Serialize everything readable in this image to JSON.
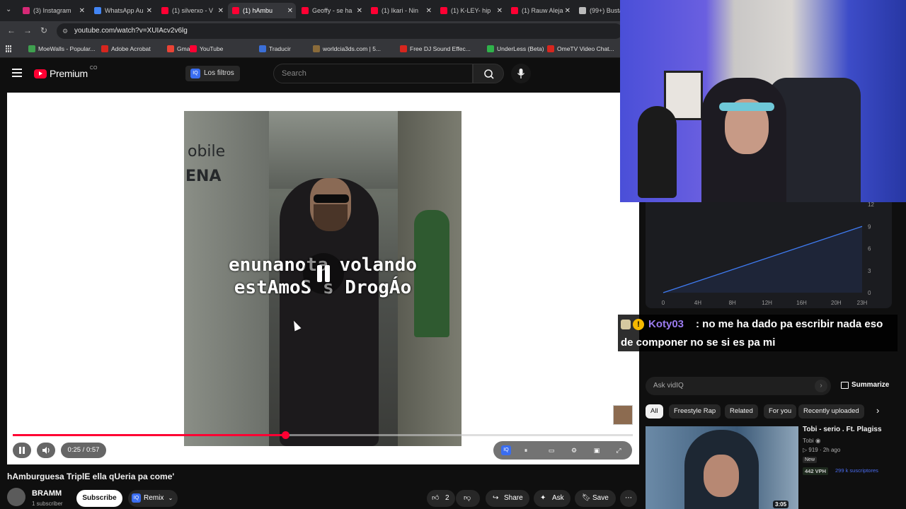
{
  "browser": {
    "tabs": [
      {
        "label": "(3) Instagram",
        "color": "#d62976"
      },
      {
        "label": "WhatsApp Au",
        "color": "#4285f4"
      },
      {
        "label": "(1) silverxo - V",
        "color": "#ff0033"
      },
      {
        "label": "(1) hAmbu",
        "color": "#ff0033",
        "active": true
      },
      {
        "label": "Geoffy - se ha",
        "color": "#ff0033"
      },
      {
        "label": "(1) Ikari - Nin",
        "color": "#ff0033"
      },
      {
        "label": "(1) K-LEY- hip",
        "color": "#ff0033"
      },
      {
        "label": "(1) Rauw Aleja",
        "color": "#ff0033"
      },
      {
        "label": "(99+) Busta",
        "color": "#bbbbbb"
      }
    ],
    "url": "youtube.com/watch?v=XUIAcv2v6lg",
    "bookmarks": [
      "MoeWalls - Popular...",
      "Adobe Acrobat",
      "Gmail",
      "YouTube",
      "Traducir",
      "worldcia3ds.com | 5...",
      "Free DJ Sound Effec...",
      "UnderLess (Beta)",
      "OmeTV Video Chat..."
    ]
  },
  "youtube": {
    "logo_text": "Premium",
    "country": "CO",
    "filters_label": "Los filtros",
    "filters_icon": "IQ",
    "search_placeholder": "Search"
  },
  "player": {
    "caption_line1": "enunanota volando",
    "caption_line2": "estAmoS   s DrogÁo",
    "sign1": "obile",
    "sign2": "ENA",
    "time": "0:25 / 0:57",
    "progress_fraction": 0.439
  },
  "video": {
    "title": "hAmburguesa TriplE ella qUeria pa come'",
    "channel": "BRAMM",
    "subscribers": "1 subscriber",
    "subscribe_label": "Subscribe",
    "remix_label": "Remix",
    "remix_icon": "IQ",
    "likes": "2",
    "share_label": "Share",
    "ask_label": "Ask",
    "save_label": "Save"
  },
  "stats_chart": {
    "y_ticks": [
      "12",
      "9",
      "6",
      "3",
      "0"
    ],
    "x_ticks": [
      "0",
      "4H",
      "8H",
      "12H",
      "16H",
      "20H",
      "23H"
    ]
  },
  "chart_data": {
    "type": "line",
    "x": [
      0,
      23
    ],
    "series": [
      {
        "values": [
          0,
          9
        ]
      }
    ],
    "ylim": [
      0,
      12
    ],
    "xticks": [
      "0",
      "4H",
      "8H",
      "12H",
      "16H",
      "20H",
      "23H"
    ],
    "yticks": [
      "0",
      "3",
      "6",
      "9",
      "12"
    ]
  },
  "chat": {
    "badge_symbol": "!",
    "username": "Koty03",
    "line1": ": no me ha dado pa escribir nada eso",
    "line2": "de componer no se si es pa mi"
  },
  "sidebar": {
    "ask_placeholder": "Ask vidIQ",
    "summarize_label": "Summarize",
    "chips": [
      "All",
      "Freestyle Rap",
      "Related",
      "For you",
      "Recently uploaded"
    ],
    "rec": {
      "title": "Tobi - serio . Ft. Plagiss",
      "channel": "Tobi",
      "meta": "▷ 919 · 2h ago",
      "badge": "New",
      "vph": "442 VPH",
      "subs": "299 k suscriptores",
      "duration": "3:05"
    }
  }
}
